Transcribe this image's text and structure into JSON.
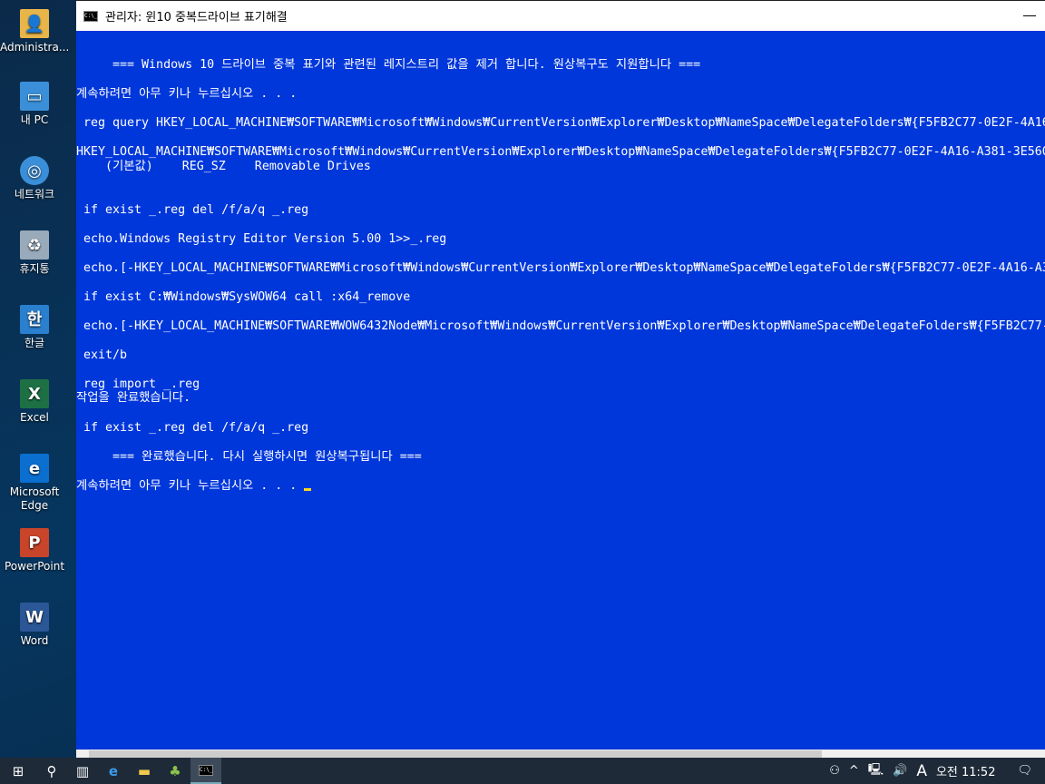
{
  "desktop": {
    "icons": [
      {
        "label": "Administra...",
        "icon": "user-folder-icon",
        "color": "#e8b54a"
      },
      {
        "label": "내 PC",
        "icon": "computer-icon",
        "color": "#3a8fd8"
      },
      {
        "label": "네트워크",
        "icon": "network-icon",
        "color": "#3a8fd8"
      },
      {
        "label": "휴지통",
        "icon": "recycle-bin-icon",
        "color": "#9ab"
      },
      {
        "label": "한글",
        "icon": "hangul-icon",
        "color": "#2a7fcf"
      },
      {
        "label": "Excel",
        "icon": "excel-icon",
        "color": "#1d7044"
      },
      {
        "label": "Microsoft Edge",
        "icon": "edge-icon",
        "color": "#0a6fcf"
      },
      {
        "label": "PowerPoint",
        "icon": "powerpoint-icon",
        "color": "#c8442a"
      },
      {
        "label": "Word",
        "icon": "word-icon",
        "color": "#2b5797"
      }
    ]
  },
  "window": {
    "title": "관리자:  윈10 중복드라이브 표기해결",
    "background": "#0037da"
  },
  "console": {
    "lines": [
      "     === Windows 10 드라이브 중복 표기와 관련된 레지스트리 값을 제거 합니다. 원상복구도 지원합니다 ===",
      "계속하려면 아무 키나 누르십시오 . . .",
      " reg query HKEY_LOCAL_MACHINE₩SOFTWARE₩Microsoft₩Windows₩CurrentVersion₩Explorer₩Desktop₩NameSpace₩DelegateFolders₩{F5FB2C77-0E2F-4A16",
      "HKEY_LOCAL_MACHINE₩SOFTWARE₩Microsoft₩Windows₩CurrentVersion₩Explorer₩Desktop₩NameSpace₩DelegateFolders₩{F5FB2C77-0E2F-4A16-A381-3E560C",
      "    (기본값)    REG_SZ    Removable Drives",
      " if exist _.reg del /f/a/q _.reg",
      " echo.Windows Registry Editor Version 5.00 1>>_.reg",
      " echo.[-HKEY_LOCAL_MACHINE₩SOFTWARE₩Microsoft₩Windows₩CurrentVersion₩Explorer₩Desktop₩NameSpace₩DelegateFolders₩{F5FB2C77-0E2F-4A16-A3",
      " if exist C:₩Windows₩SysWOW64 call :x64_remove",
      " echo.[-HKEY_LOCAL_MACHINE₩SOFTWARE₩WOW6432Node₩Microsoft₩Windows₩CurrentVersion₩Explorer₩Desktop₩NameSpace₩DelegateFolders₩{F5FB2C77-",
      " exit/b",
      " reg import _.reg",
      "작업을 완료했습니다.",
      " if exist _.reg del /f/a/q _.reg",
      "     === 완료했습니다. 다시 실행하시면 원상복구됩니다 ===",
      "계속하려면 아무 키나 누르십시오 . . . "
    ]
  },
  "taskbar": {
    "time": "오전 11:52",
    "ime": "A"
  }
}
